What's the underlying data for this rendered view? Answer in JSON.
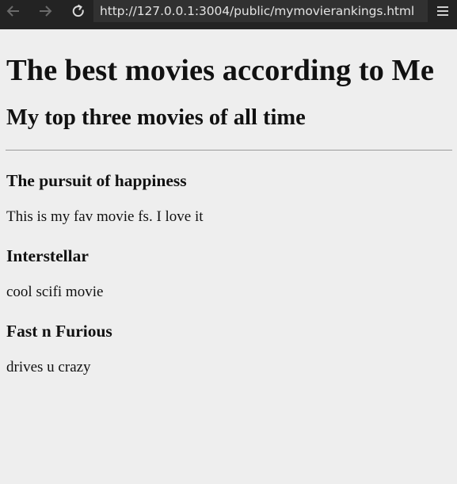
{
  "browser": {
    "url": "http://127.0.0.1:3004/public/mymovierankings.html",
    "back_icon": "arrow-left-icon",
    "forward_icon": "arrow-right-icon",
    "reload_icon": "reload-icon",
    "menu_icon": "hamburger-menu-icon"
  },
  "page": {
    "title": "The best movies according to Me",
    "subtitle": "My top three movies of all time",
    "movies": [
      {
        "name": "The pursuit of happiness",
        "description": "This is my fav movie fs. I love it"
      },
      {
        "name": "Interstellar",
        "description": "cool scifi movie"
      },
      {
        "name": "Fast n Furious",
        "description": "drives u crazy"
      }
    ]
  },
  "colors": {
    "background": "#eeeeee",
    "toolbar": "#232323",
    "url_field": "#313131"
  }
}
